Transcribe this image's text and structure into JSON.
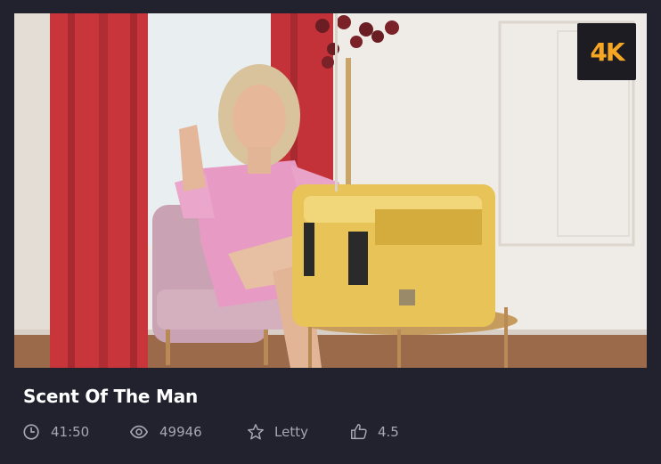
{
  "video": {
    "title": "Scent Of The Man",
    "quality_badge": "4K",
    "duration": "41:50",
    "views": "49946",
    "model": "Letty",
    "rating": "4.5"
  },
  "colors": {
    "background": "#22222e",
    "badge_bg": "#1c1c22",
    "badge_text": "#f5a623",
    "title": "#ffffff",
    "meta_text": "#a7a7b3"
  },
  "icons": {
    "duration": "clock-icon",
    "views": "eye-icon",
    "model": "star-icon",
    "rating": "thumbs-up-icon"
  }
}
